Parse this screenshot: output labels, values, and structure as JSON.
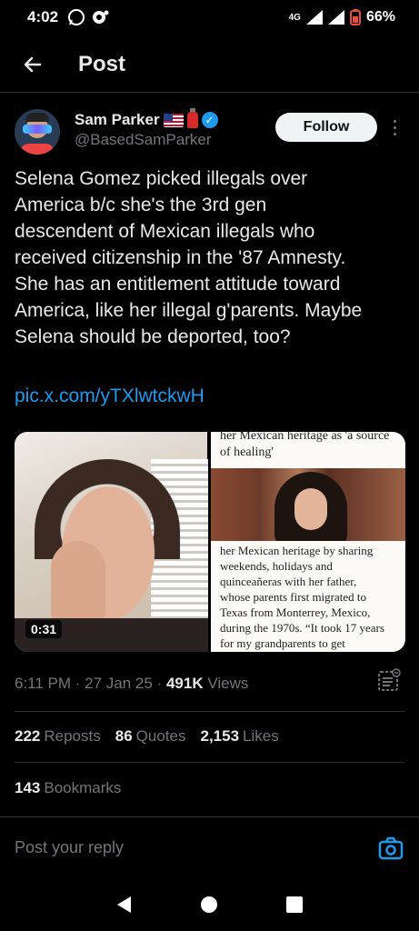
{
  "status": {
    "time": "4:02",
    "network": "4G",
    "battery": "66%"
  },
  "header": {
    "title": "Post"
  },
  "author": {
    "name": "Sam Parker",
    "handle": "@BasedSamParker"
  },
  "follow_label": "Follow",
  "tweet": {
    "text": "Selena Gomez picked illegals over\nAmerica b/c she's the 3rd gen\ndescendent of Mexican illegals who\nreceived citizenship in the '87 Amnesty.\nShe has an entitlement attitude toward\nAmerica, like her illegal g'parents. Maybe\nSelena should be deported, too?",
    "link": "pic.x.com/yTXlwtckwH"
  },
  "media": {
    "duration": "0:31",
    "article_head": "her Mexican heritage as 'a source of healing'",
    "article_body": "her Mexican heritage by sharing\nweekends, holidays and\nquinceañeras with her father,\nwhose parents first migrated to\nTexas from Monterrey, Mexico,\nduring the 1970s. “It took 17 years\nfor my grandparents to get"
  },
  "meta": {
    "time": "6:11 PM",
    "date": "27 Jan 25",
    "views_count": "491K",
    "views_label": "Views"
  },
  "stats": {
    "reposts_count": "222",
    "reposts_label": "Reposts",
    "quotes_count": "86",
    "quotes_label": "Quotes",
    "likes_count": "2,153",
    "likes_label": "Likes",
    "bookmarks_count": "143",
    "bookmarks_label": "Bookmarks"
  },
  "reply": {
    "placeholder": "Post your reply"
  },
  "colors": {
    "accent": "#1d9bf0",
    "background": "#000000",
    "muted": "#71767b"
  },
  "icons": [
    "back-arrow-icon",
    "whatsapp-icon",
    "notification-icon",
    "signal-icon",
    "battery-icon",
    "verified-icon",
    "more-icon",
    "analytics-icon",
    "camera-icon",
    "nav-back-icon",
    "nav-home-icon",
    "nav-recents-icon"
  ]
}
